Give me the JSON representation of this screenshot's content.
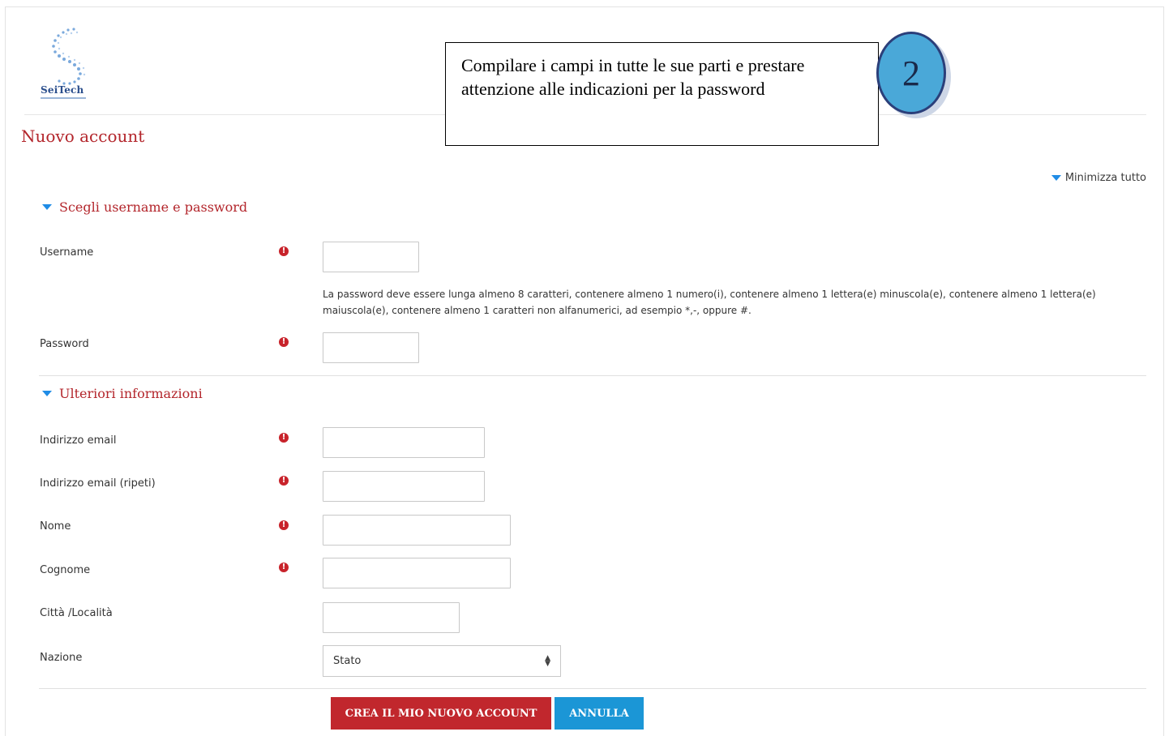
{
  "header": {
    "logo_text": "SeiTech",
    "page_title": "Nuovo account"
  },
  "callout": {
    "text": "Compilare i campi in tutte le sue parti e prestare attenzione alle indicazioni  per la password",
    "step_number": "2"
  },
  "toolbar": {
    "collapse_all_label": "Minimizza tutto"
  },
  "sections": {
    "credentials": {
      "title": "Scegli username e password",
      "username_label": "Username",
      "username_value": "",
      "password_hint": "La password deve essere lunga almeno 8 caratteri, contenere almeno 1 numero(i), contenere almeno 1 lettera(e) minuscola(e), contenere almeno 1 lettera(e) maiuscola(e), contenere almeno 1 caratteri non alfanumerici, ad esempio *,-, oppure #.",
      "password_label": "Password",
      "password_value": ""
    },
    "more_info": {
      "title": "Ulteriori informazioni",
      "email_label": "Indirizzo email",
      "email_value": "",
      "email_repeat_label": "Indirizzo email (ripeti)",
      "email_repeat_value": "",
      "first_name_label": "Nome",
      "first_name_value": "",
      "last_name_label": "Cognome",
      "last_name_value": "",
      "city_label": "Città /Località",
      "city_value": "",
      "country_label": "Nazione",
      "country_selected": "Stato"
    }
  },
  "actions": {
    "submit_label": "CREA IL MIO NUOVO ACCOUNT",
    "cancel_label": "ANNULLA"
  },
  "colors": {
    "brand_red": "#b3252b",
    "primary_button": "#c1272d",
    "cancel_button": "#1b96d6",
    "required_icon": "#c8232b",
    "badge_fill": "#4aa8d8"
  },
  "icons": {
    "required": "exclamation-circle-icon",
    "section_toggle": "caret-down-icon",
    "select_toggle": "sort-arrows-icon"
  }
}
